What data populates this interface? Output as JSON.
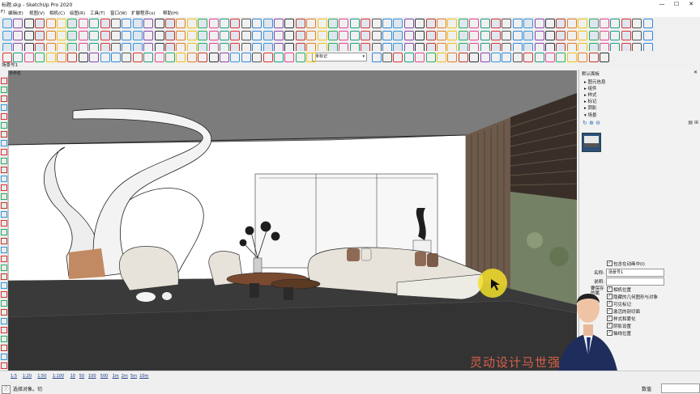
{
  "app": {
    "title": "标题.skp - SketchUp Pro 2020",
    "minimize": "—",
    "maximize": "☐",
    "close": "✕"
  },
  "menu": [
    "F)",
    "编辑(E)",
    "视图(V)",
    "相机(C)",
    "绘图(R)",
    "工具(T)",
    "窗口(W)",
    "扩展程序(x)",
    "帮助(H)"
  ],
  "scene_tab": "场景号1",
  "viewport_label": "未命名",
  "layer_dropdown": "未标记",
  "default_panel": {
    "title": "默认面板",
    "sections": [
      "图元信息",
      "组件",
      "样式",
      "标记",
      "阴影",
      "场景"
    ],
    "scene_name_label": "名称:",
    "scene_name_value": "场景号1",
    "scene_desc_label": "说明:",
    "include_animation": "包含在动画中(I)",
    "save_props_label": "要保存的属性:",
    "properties": [
      "相机位置",
      "隐藏的几何图形与对象",
      "可见标记",
      "激活的剖切面",
      "样式和雾化",
      "阴影设置",
      "轴线位置"
    ]
  },
  "status": {
    "prompt": "选择对象。切",
    "measure_label": "数值",
    "scale_buttons": [
      "1:5",
      "1:20",
      "1:50",
      "1:100",
      "10",
      "50",
      "100",
      "500",
      "1m",
      "2m",
      "5m",
      "10m"
    ]
  },
  "watermark": "灵动设计马世强",
  "colors": {
    "viewport_bg": "#7c7c7c",
    "floor": "#3a3a3a",
    "wall": "#ffffff",
    "sofa": "#e7e2da",
    "cushion": "#8e6a55",
    "wood": "#7a4a30",
    "cursor_highlight": "#f2df2c"
  }
}
